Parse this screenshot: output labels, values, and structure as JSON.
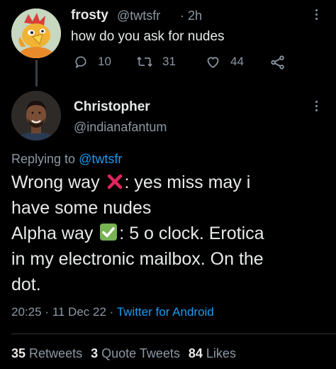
{
  "parent_tweet": {
    "display_name": "frosty",
    "handle": "@twtsfr",
    "separator": "·",
    "time": "2h",
    "text": "how do you ask for nudes",
    "replies": "10",
    "retweets": "31",
    "likes": "44"
  },
  "main_tweet": {
    "display_name": "Christopher",
    "handle": "@indianafantum",
    "replying_prefix": "Replying to",
    "replying_to": "@twtsfr",
    "lines": [
      {
        "before": "Wrong way ",
        "emoji": "cross-mark-emoji",
        "after": ": yes miss may i"
      },
      {
        "text": "have some nudes"
      },
      {
        "before": "Alpha way ",
        "emoji": "check-mark-button-emoji",
        "after": ": 5 o clock. Erotica"
      },
      {
        "text": "in my electronic mailbox. On the"
      },
      {
        "text": "dot."
      }
    ],
    "time": "20:25",
    "date": "11 Dec 22",
    "meta_separator": "·",
    "source": "Twitter for Android",
    "stats": {
      "retweets_count": "35",
      "retweets_label": "Retweets",
      "quotes_count": "3",
      "quotes_label": "Quote Tweets",
      "likes_count": "84",
      "likes_label": "Likes"
    }
  },
  "colors": {
    "background": "#000000",
    "text": "#e7e9ea",
    "muted": "#8b98a5",
    "link": "#1d9bf0",
    "divider": "#2f3336",
    "cross": "#e0245e",
    "check": "#77b255"
  },
  "icons": {
    "reply": "reply-icon",
    "retweet": "retweet-icon",
    "like": "heart-icon",
    "share": "share-icon",
    "more": "more-options-icon"
  }
}
